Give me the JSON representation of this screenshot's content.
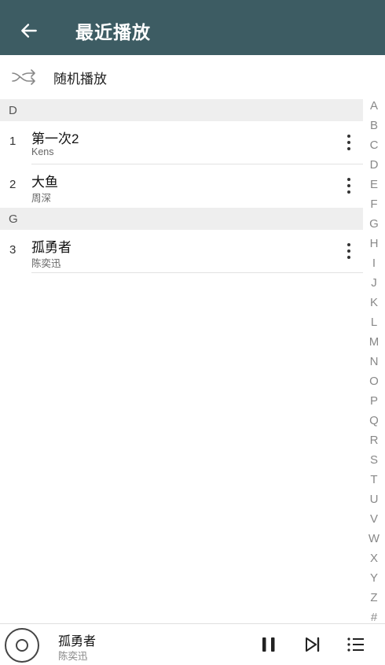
{
  "header": {
    "title": "最近播放",
    "back_icon": "arrow-left-icon",
    "background": "#3d5c63"
  },
  "shuffle": {
    "label": "随机播放",
    "icon": "shuffle-icon"
  },
  "sections": [
    {
      "letter": "D",
      "songs": [
        {
          "index": "1",
          "title": "第一次2",
          "artist": "Kens"
        },
        {
          "index": "2",
          "title": "大鱼",
          "artist": "周深"
        }
      ]
    },
    {
      "letter": "G",
      "songs": [
        {
          "index": "3",
          "title": "孤勇者",
          "artist": "陈奕迅"
        }
      ]
    }
  ],
  "index_letters": [
    "A",
    "B",
    "C",
    "D",
    "E",
    "F",
    "G",
    "H",
    "I",
    "J",
    "K",
    "L",
    "M",
    "N",
    "O",
    "P",
    "Q",
    "R",
    "S",
    "T",
    "U",
    "V",
    "W",
    "X",
    "Y",
    "Z",
    "#"
  ],
  "player": {
    "title": "孤勇者",
    "artist": "陈奕迅",
    "disc_icon": "disc-icon",
    "pause_icon": "pause-icon",
    "next_icon": "skip-next-icon",
    "playlist_icon": "playlist-icon"
  }
}
